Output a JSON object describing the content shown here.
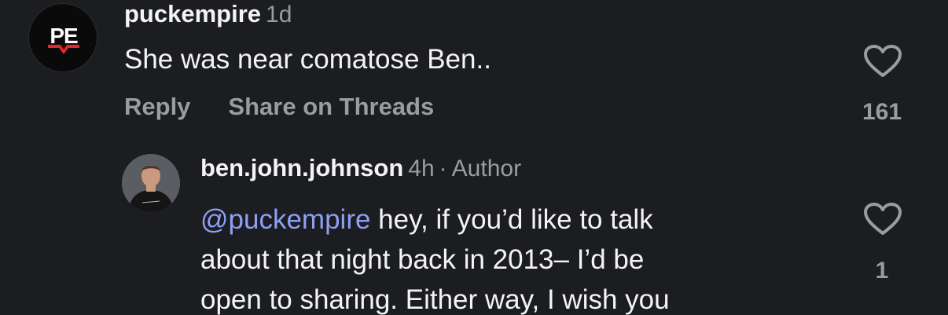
{
  "comment1": {
    "username": "puckempire",
    "time": "1d",
    "text": "She was near comatose Ben..",
    "reply_label": "Reply",
    "share_label": "Share on Threads",
    "like_count": "161",
    "avatar_logo_text": "PE"
  },
  "comment2": {
    "username": "ben.john.johnson",
    "time": "4h",
    "separator": "·",
    "author_label": "Author",
    "mention": "@puckempire",
    "line1_rest": " hey, if you’d like to talk",
    "line2": "about that night back in 2013– I’d be",
    "line3": "open to sharing. Either way, I wish you",
    "like_count": "1"
  },
  "colors": {
    "background": "#1b1d20",
    "text_primary": "#f4f4f4",
    "text_secondary": "#9a9ca0",
    "mention": "#8f9ff5"
  },
  "icons": {
    "like": "heart-outline-icon"
  }
}
